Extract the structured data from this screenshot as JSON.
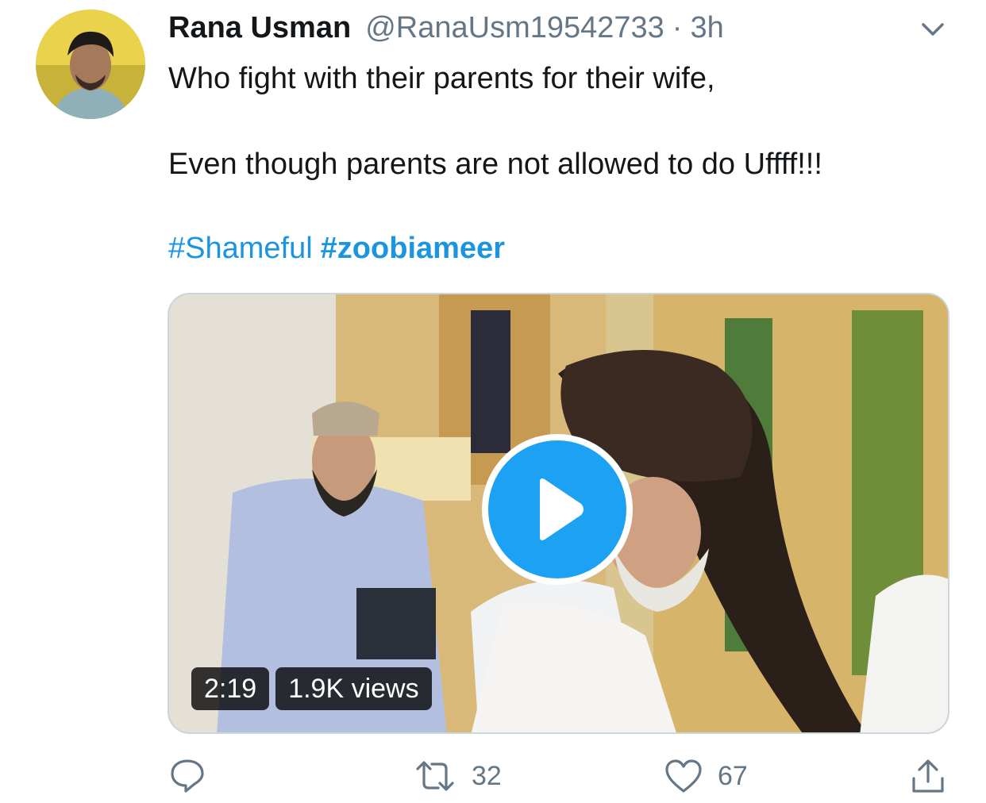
{
  "tweet": {
    "author_name": "Rana Usman",
    "author_handle": "@RanaUsm19542733",
    "separator": "·",
    "time": "3h",
    "text_line1": "Who fight with their parents for their wife,",
    "text_line2": "Even though parents are not allowed to do Uffff!!!",
    "hashtags": [
      "#Shameful",
      "#zoobiameer"
    ]
  },
  "media": {
    "duration": "2:19",
    "views": "1.9K views",
    "play_icon": "play-icon"
  },
  "actions": {
    "reply_icon": "reply-icon",
    "retweet_icon": "retweet-icon",
    "retweet_count": "32",
    "like_icon": "heart-icon",
    "like_count": "67",
    "share_icon": "share-icon"
  },
  "colors": {
    "link": "#1b95e0",
    "play_button": "#1da1f2",
    "secondary_text": "#657786"
  }
}
